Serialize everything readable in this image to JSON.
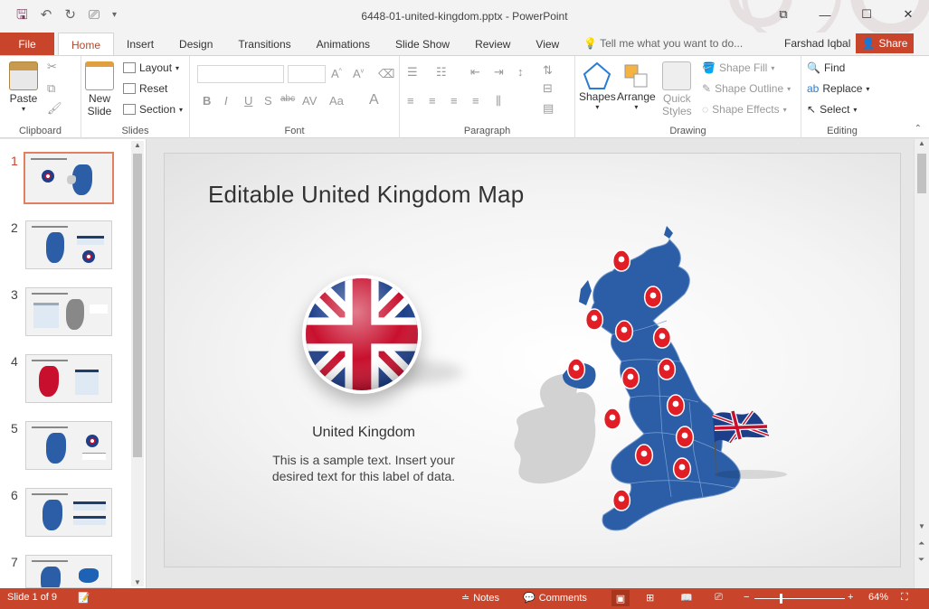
{
  "window": {
    "title": "6448-01-united-kingdom.pptx - PowerPoint",
    "quick_access": [
      "save-icon",
      "undo-icon",
      "redo-icon",
      "present-icon",
      "customize-icon"
    ],
    "controls": [
      "ribbon-display-icon",
      "minimize-icon",
      "maximize-icon",
      "close-icon"
    ]
  },
  "tabs": {
    "file": "File",
    "items": [
      "Home",
      "Insert",
      "Design",
      "Transitions",
      "Animations",
      "Slide Show",
      "Review",
      "View"
    ],
    "active": "Home",
    "tell_me": "Tell me what you want to do...",
    "user": "Farshad Iqbal",
    "share": "Share"
  },
  "ribbon": {
    "clipboard": {
      "label": "Clipboard",
      "paste": "Paste"
    },
    "slides": {
      "label": "Slides",
      "new_slide_1": "New",
      "new_slide_2": "Slide",
      "layout": "Layout",
      "reset": "Reset",
      "section": "Section"
    },
    "font": {
      "label": "Font"
    },
    "paragraph": {
      "label": "Paragraph"
    },
    "drawing": {
      "label": "Drawing",
      "shapes": "Shapes",
      "arrange": "Arrange",
      "quick_styles_1": "Quick",
      "quick_styles_2": "Styles",
      "shape_fill": "Shape Fill",
      "shape_outline": "Shape Outline",
      "shape_effects": "Shape Effects"
    },
    "editing": {
      "label": "Editing",
      "find": "Find",
      "replace": "Replace",
      "select": "Select"
    }
  },
  "thumbnails": {
    "numbers": [
      "1",
      "2",
      "3",
      "4",
      "5",
      "6",
      "7"
    ],
    "selected": 1
  },
  "slide": {
    "title": "Editable United Kingdom Map",
    "country": "United Kingdom",
    "sample_line1": "This is a sample text. Insert your",
    "sample_line2": "desired text for this label of data."
  },
  "status": {
    "slide_of": "Slide 1 of 9",
    "notes": "Notes",
    "comments": "Comments",
    "zoom": "64%"
  },
  "colors": {
    "accent": "#c8442b",
    "map_blue": "#2b5ea7",
    "ireland_gray": "#d2d2d2",
    "pin_red": "#e11d25"
  }
}
